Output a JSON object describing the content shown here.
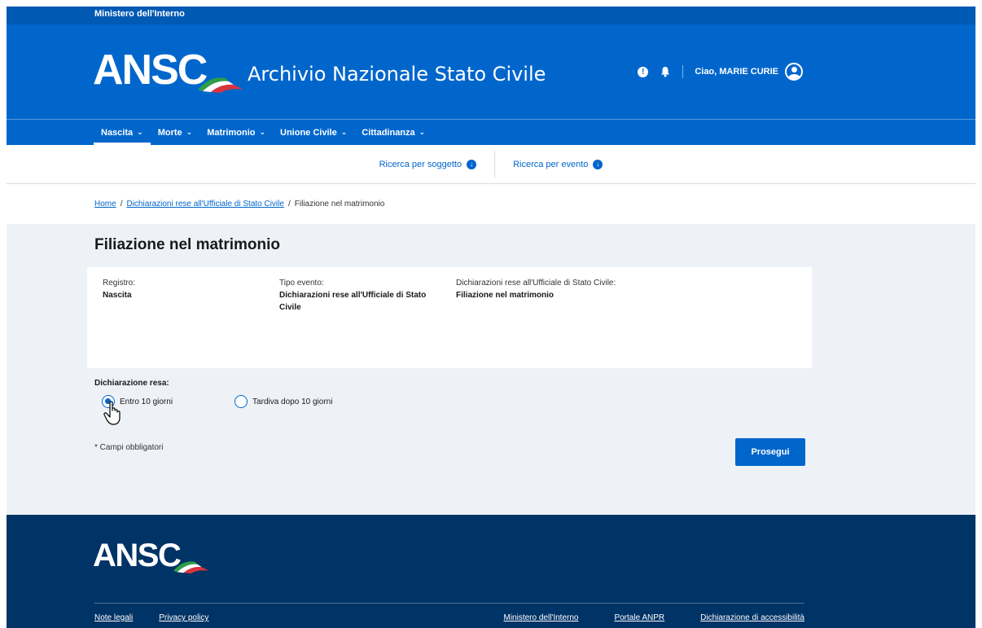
{
  "ministry": "Ministero dell'Interno",
  "header": {
    "logo_text": "ANSC",
    "app_title": "Archivio Nazionale Stato Civile",
    "greeting": "Ciao, MARIE CURIE",
    "alert_glyph": "!"
  },
  "nav": {
    "items": [
      {
        "label": "Nascita"
      },
      {
        "label": "Morte"
      },
      {
        "label": "Matrimonio"
      },
      {
        "label": "Unione Civile"
      },
      {
        "label": "Cittadinanza"
      }
    ]
  },
  "subnav": {
    "items": [
      {
        "label": "Ricerca per soggetto"
      },
      {
        "label": "Ricerca per evento"
      }
    ]
  },
  "breadcrumb": {
    "home": "Home",
    "level1": "Dichiarazioni rese all'Ufficiale di Stato Civile",
    "current": "Filiazione nel matrimonio",
    "separator": "/"
  },
  "main": {
    "title": "Filiazione nel matrimonio",
    "fields": [
      {
        "label": "Registro:",
        "value": "Nascita"
      },
      {
        "label": "Tipo evento:",
        "value": "Dichiarazioni rese all'Ufficiale di Stato Civile"
      },
      {
        "label": "Dichiarazioni rese all'Ufficiale di Stato Civile:",
        "value": "Filiazione nel matrimonio"
      }
    ],
    "radio_label": "Dichiarazione resa:",
    "radio_options": [
      {
        "label": "Entro 10 giorni",
        "checked": true
      },
      {
        "label": "Tardiva dopo 10 giorni",
        "checked": false
      }
    ],
    "required_note": "* Campi obbligatori",
    "submit_label": "Prosegui"
  },
  "footer": {
    "logo_text": "ANSC",
    "links_left": [
      "Note legali",
      "Privacy policy"
    ],
    "links_right": [
      "Ministero dell'Interno",
      "Portale ANPR",
      "Dichiarazione di accessibilità"
    ]
  },
  "colors": {
    "primary": "#0066cc",
    "ministry_bar": "#0059b3",
    "footer": "#003366",
    "main_bg": "#eef2f7"
  }
}
